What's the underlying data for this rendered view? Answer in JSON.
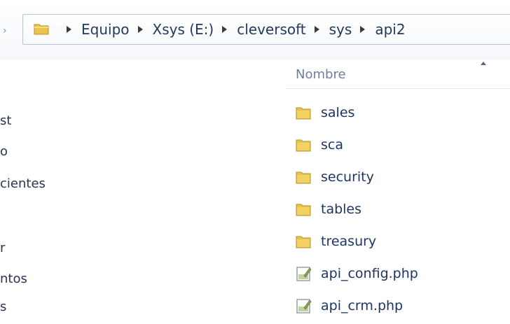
{
  "address_bar": {
    "crumbs": [
      "Equipo",
      "Xsys (E:)",
      "cleversoft",
      "sys",
      "api2"
    ]
  },
  "nav_pane": {
    "items": [
      "st",
      "o",
      "cientes",
      "",
      "r",
      "ntos",
      "s"
    ]
  },
  "file_list": {
    "column_header": "Nombre",
    "rows": [
      {
        "name": "sales",
        "type": "folder"
      },
      {
        "name": "sca",
        "type": "folder"
      },
      {
        "name": "security",
        "type": "folder"
      },
      {
        "name": "tables",
        "type": "folder"
      },
      {
        "name": "treasury",
        "type": "folder"
      },
      {
        "name": "api_config.php",
        "type": "php-file"
      },
      {
        "name": "api_crm.php",
        "type": "php-file"
      }
    ]
  },
  "colors": {
    "folder": "#e8c44a",
    "text": "#1e3563",
    "header_text": "#6f7f99"
  }
}
